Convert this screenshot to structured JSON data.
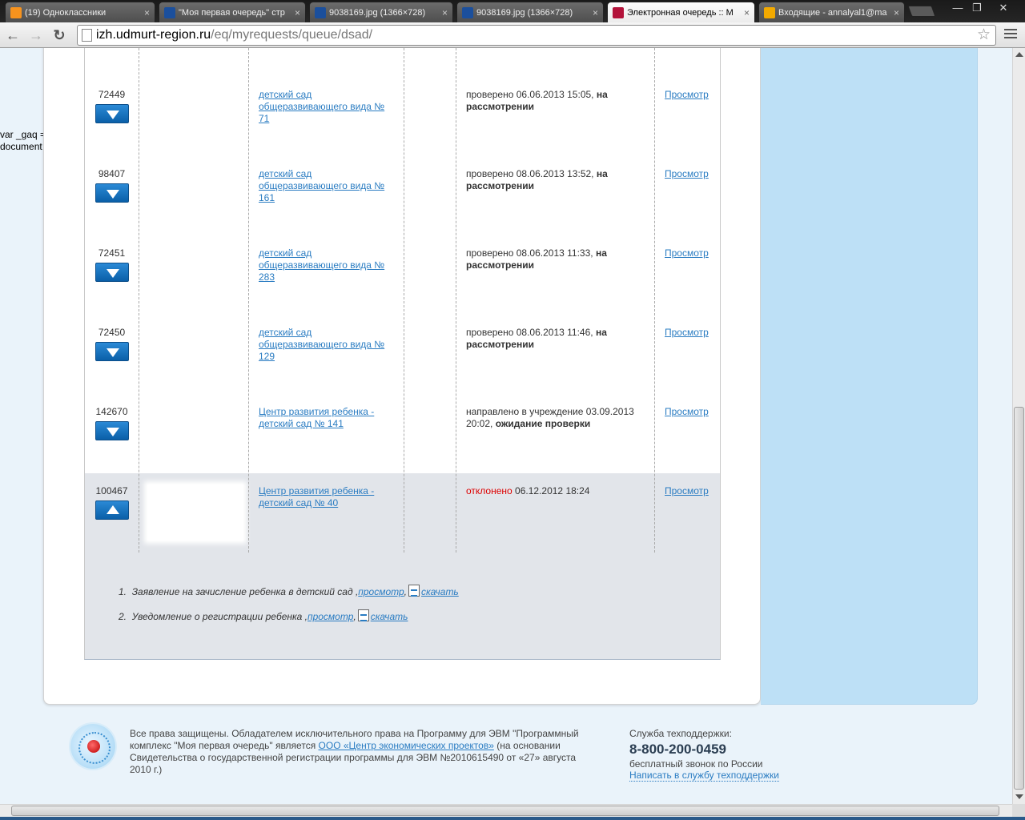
{
  "browser": {
    "tabs": [
      {
        "title": "(19) Одноклассники",
        "favicon": "odnoklassniki-icon",
        "color": "#f7931e",
        "active": false
      },
      {
        "title": "\"Моя первая очередь\" стр",
        "favicon": "mail-envelope-icon",
        "color": "#1b4f9c",
        "active": false
      },
      {
        "title": "9038169.jpg (1366×728)",
        "favicon": "mail-envelope-icon",
        "color": "#1b4f9c",
        "active": false
      },
      {
        "title": "9038169.jpg (1366×728)",
        "favicon": "mail-envelope-icon",
        "color": "#1b4f9c",
        "active": false
      },
      {
        "title": "Электронная очередь :: М",
        "favicon": "queue-site-icon",
        "color": "#b3123a",
        "active": true
      },
      {
        "title": "Входящие - annalyal1@ma",
        "favicon": "at-sign-icon",
        "color": "#f2a900",
        "active": false
      }
    ],
    "url_host": "izh.udmurt-region.ru",
    "url_path": "/eq/myrequests/queue/dsad/",
    "window_controls": {
      "minimize": "—",
      "restore": "❐",
      "close": "✕"
    }
  },
  "page": {
    "gaq_lines": [
      "var _gaq =",
      "document"
    ],
    "requests": [
      {
        "id": "72449",
        "arrow": "down",
        "institution": "детский сад общеразвивающего вида № 71",
        "status_prefix": "проверено 06.06.2013 15:05,",
        "status_bold": "на рассмотрении",
        "status_rejected": "",
        "view": "Просмотр",
        "grey": false
      },
      {
        "id": "98407",
        "arrow": "down",
        "institution": "детский сад общеразвивающего вида № 161",
        "status_prefix": "проверено 08.06.2013 13:52,",
        "status_bold": "на рассмотрении",
        "status_rejected": "",
        "view": "Просмотр",
        "grey": false
      },
      {
        "id": "72451",
        "arrow": "down",
        "institution": "детский сад общеразвивающего вида № 283",
        "status_prefix": "проверено 08.06.2013 11:33,",
        "status_bold": "на рассмотрении",
        "status_rejected": "",
        "view": "Просмотр",
        "grey": false
      },
      {
        "id": "72450",
        "arrow": "down",
        "institution": "детский сад общеразвивающего вида № 129",
        "status_prefix": "проверено 08.06.2013 11:46,",
        "status_bold": "на рассмотрении",
        "status_rejected": "",
        "view": "Просмотр",
        "grey": false
      },
      {
        "id": "142670",
        "arrow": "down",
        "institution": "Центр развития ребенка - детский сад № 141",
        "status_prefix": "направлено в учреждение 03.09.2013 20:02,",
        "status_bold": "ожидание проверки",
        "status_rejected": "",
        "view": "Просмотр",
        "grey": false
      },
      {
        "id": "100467",
        "arrow": "up",
        "institution": "Центр развития ребенка - детский сад № 40",
        "status_prefix": "06.12.2012 18:24",
        "status_bold": "",
        "status_rejected": "отклонено",
        "view": "Просмотр",
        "grey": true
      }
    ],
    "documents": [
      {
        "num": "1.",
        "label": "Заявление на зачисление ребенка в детский сад",
        "view_link": "просмотр",
        "download_link": "скачать"
      },
      {
        "num": "2.",
        "label": "Уведомление о регистрации ребенка",
        "view_link": "просмотр",
        "download_link": "скачать"
      }
    ]
  },
  "footer": {
    "copyright_before": "Все права защищены. Обладателем исключительного права на Программу для ЭВМ \"Программный комплекс \"Моя первая очередь\" является",
    "company_link": "ООО «Центр экономических проектов»",
    "copyright_after": "(на основании Свидетельства о государственной регистрации программы для ЭВМ №2010615490 от «27» августа 2010 г.)",
    "support_label": "Служба техподдержки:",
    "support_phone": "8-800-200-0459",
    "support_free": "бесплатный звонок по России",
    "support_link": "Написать в службу техподдержки"
  }
}
